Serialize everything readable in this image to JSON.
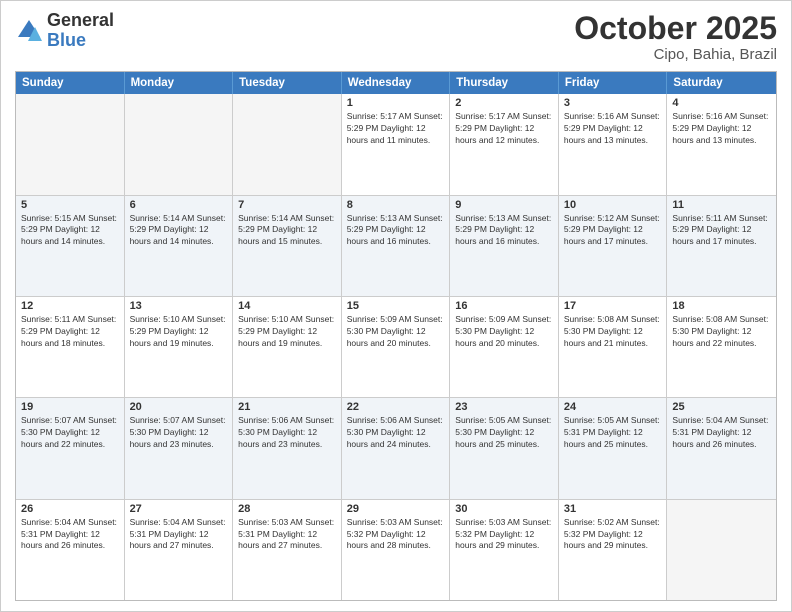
{
  "header": {
    "logo_general": "General",
    "logo_blue": "Blue",
    "month": "October 2025",
    "location": "Cipo, Bahia, Brazil"
  },
  "days_of_week": [
    "Sunday",
    "Monday",
    "Tuesday",
    "Wednesday",
    "Thursday",
    "Friday",
    "Saturday"
  ],
  "rows": [
    {
      "alt": false,
      "cells": [
        {
          "day": "",
          "info": ""
        },
        {
          "day": "",
          "info": ""
        },
        {
          "day": "",
          "info": ""
        },
        {
          "day": "1",
          "info": "Sunrise: 5:17 AM\nSunset: 5:29 PM\nDaylight: 12 hours\nand 11 minutes."
        },
        {
          "day": "2",
          "info": "Sunrise: 5:17 AM\nSunset: 5:29 PM\nDaylight: 12 hours\nand 12 minutes."
        },
        {
          "day": "3",
          "info": "Sunrise: 5:16 AM\nSunset: 5:29 PM\nDaylight: 12 hours\nand 13 minutes."
        },
        {
          "day": "4",
          "info": "Sunrise: 5:16 AM\nSunset: 5:29 PM\nDaylight: 12 hours\nand 13 minutes."
        }
      ]
    },
    {
      "alt": true,
      "cells": [
        {
          "day": "5",
          "info": "Sunrise: 5:15 AM\nSunset: 5:29 PM\nDaylight: 12 hours\nand 14 minutes."
        },
        {
          "day": "6",
          "info": "Sunrise: 5:14 AM\nSunset: 5:29 PM\nDaylight: 12 hours\nand 14 minutes."
        },
        {
          "day": "7",
          "info": "Sunrise: 5:14 AM\nSunset: 5:29 PM\nDaylight: 12 hours\nand 15 minutes."
        },
        {
          "day": "8",
          "info": "Sunrise: 5:13 AM\nSunset: 5:29 PM\nDaylight: 12 hours\nand 16 minutes."
        },
        {
          "day": "9",
          "info": "Sunrise: 5:13 AM\nSunset: 5:29 PM\nDaylight: 12 hours\nand 16 minutes."
        },
        {
          "day": "10",
          "info": "Sunrise: 5:12 AM\nSunset: 5:29 PM\nDaylight: 12 hours\nand 17 minutes."
        },
        {
          "day": "11",
          "info": "Sunrise: 5:11 AM\nSunset: 5:29 PM\nDaylight: 12 hours\nand 17 minutes."
        }
      ]
    },
    {
      "alt": false,
      "cells": [
        {
          "day": "12",
          "info": "Sunrise: 5:11 AM\nSunset: 5:29 PM\nDaylight: 12 hours\nand 18 minutes."
        },
        {
          "day": "13",
          "info": "Sunrise: 5:10 AM\nSunset: 5:29 PM\nDaylight: 12 hours\nand 19 minutes."
        },
        {
          "day": "14",
          "info": "Sunrise: 5:10 AM\nSunset: 5:29 PM\nDaylight: 12 hours\nand 19 minutes."
        },
        {
          "day": "15",
          "info": "Sunrise: 5:09 AM\nSunset: 5:30 PM\nDaylight: 12 hours\nand 20 minutes."
        },
        {
          "day": "16",
          "info": "Sunrise: 5:09 AM\nSunset: 5:30 PM\nDaylight: 12 hours\nand 20 minutes."
        },
        {
          "day": "17",
          "info": "Sunrise: 5:08 AM\nSunset: 5:30 PM\nDaylight: 12 hours\nand 21 minutes."
        },
        {
          "day": "18",
          "info": "Sunrise: 5:08 AM\nSunset: 5:30 PM\nDaylight: 12 hours\nand 22 minutes."
        }
      ]
    },
    {
      "alt": true,
      "cells": [
        {
          "day": "19",
          "info": "Sunrise: 5:07 AM\nSunset: 5:30 PM\nDaylight: 12 hours\nand 22 minutes."
        },
        {
          "day": "20",
          "info": "Sunrise: 5:07 AM\nSunset: 5:30 PM\nDaylight: 12 hours\nand 23 minutes."
        },
        {
          "day": "21",
          "info": "Sunrise: 5:06 AM\nSunset: 5:30 PM\nDaylight: 12 hours\nand 23 minutes."
        },
        {
          "day": "22",
          "info": "Sunrise: 5:06 AM\nSunset: 5:30 PM\nDaylight: 12 hours\nand 24 minutes."
        },
        {
          "day": "23",
          "info": "Sunrise: 5:05 AM\nSunset: 5:30 PM\nDaylight: 12 hours\nand 25 minutes."
        },
        {
          "day": "24",
          "info": "Sunrise: 5:05 AM\nSunset: 5:31 PM\nDaylight: 12 hours\nand 25 minutes."
        },
        {
          "day": "25",
          "info": "Sunrise: 5:04 AM\nSunset: 5:31 PM\nDaylight: 12 hours\nand 26 minutes."
        }
      ]
    },
    {
      "alt": false,
      "cells": [
        {
          "day": "26",
          "info": "Sunrise: 5:04 AM\nSunset: 5:31 PM\nDaylight: 12 hours\nand 26 minutes."
        },
        {
          "day": "27",
          "info": "Sunrise: 5:04 AM\nSunset: 5:31 PM\nDaylight: 12 hours\nand 27 minutes."
        },
        {
          "day": "28",
          "info": "Sunrise: 5:03 AM\nSunset: 5:31 PM\nDaylight: 12 hours\nand 27 minutes."
        },
        {
          "day": "29",
          "info": "Sunrise: 5:03 AM\nSunset: 5:32 PM\nDaylight: 12 hours\nand 28 minutes."
        },
        {
          "day": "30",
          "info": "Sunrise: 5:03 AM\nSunset: 5:32 PM\nDaylight: 12 hours\nand 29 minutes."
        },
        {
          "day": "31",
          "info": "Sunrise: 5:02 AM\nSunset: 5:32 PM\nDaylight: 12 hours\nand 29 minutes."
        },
        {
          "day": "",
          "info": ""
        }
      ]
    }
  ]
}
